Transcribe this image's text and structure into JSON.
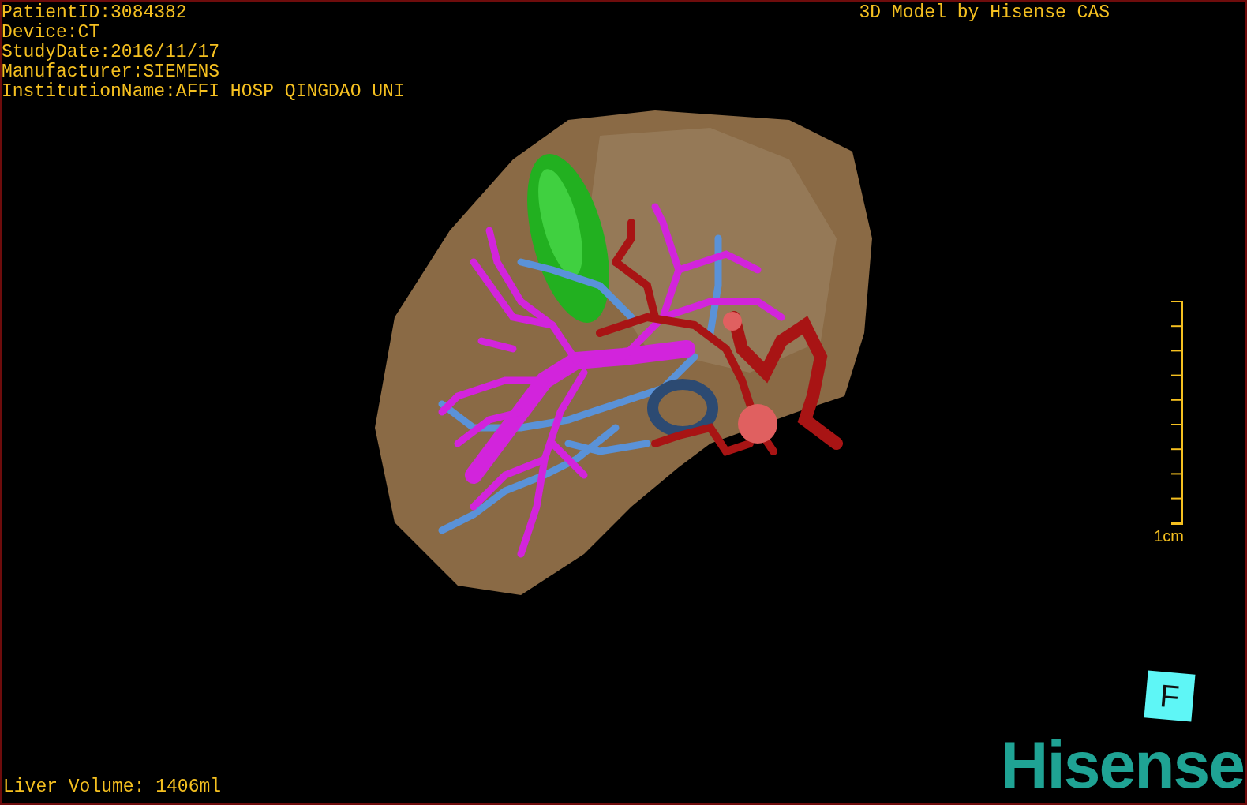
{
  "info_lines": [
    "PatientID:3084382",
    "Device:CT",
    "StudyDate:2016/11/17",
    "Manufacturer:SIEMENS",
    "InstitutionName:AFFI HOSP QINGDAO UNI"
  ],
  "title": "3D Model by Hisense CAS",
  "scale_bar": {
    "label": "1cm"
  },
  "orientation_cube": {
    "face": "F"
  },
  "logo": "Hisense",
  "liver_volume": "Liver Volume: 1406ml"
}
